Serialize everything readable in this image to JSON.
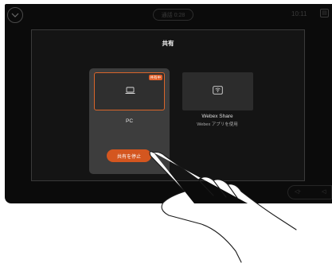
{
  "header": {
    "call_time": "通話 0:28",
    "clock": "10:11"
  },
  "dialog": {
    "title": "共有",
    "pc_card": {
      "badge": "共有中",
      "label": "PC",
      "stop_button": "共有を停止"
    },
    "webex_card": {
      "title": "Webex Share",
      "subtitle": "Webex アプリを使用"
    }
  },
  "colors": {
    "accent": "#d4561f",
    "screen_bg": "#0b0b0b",
    "card_bg": "#3d3d3d"
  },
  "icons": [
    "chevron-down-icon",
    "layout-icon",
    "laptop-icon",
    "wireless-share-icon",
    "volume-down-icon",
    "volume-up-icon"
  ]
}
